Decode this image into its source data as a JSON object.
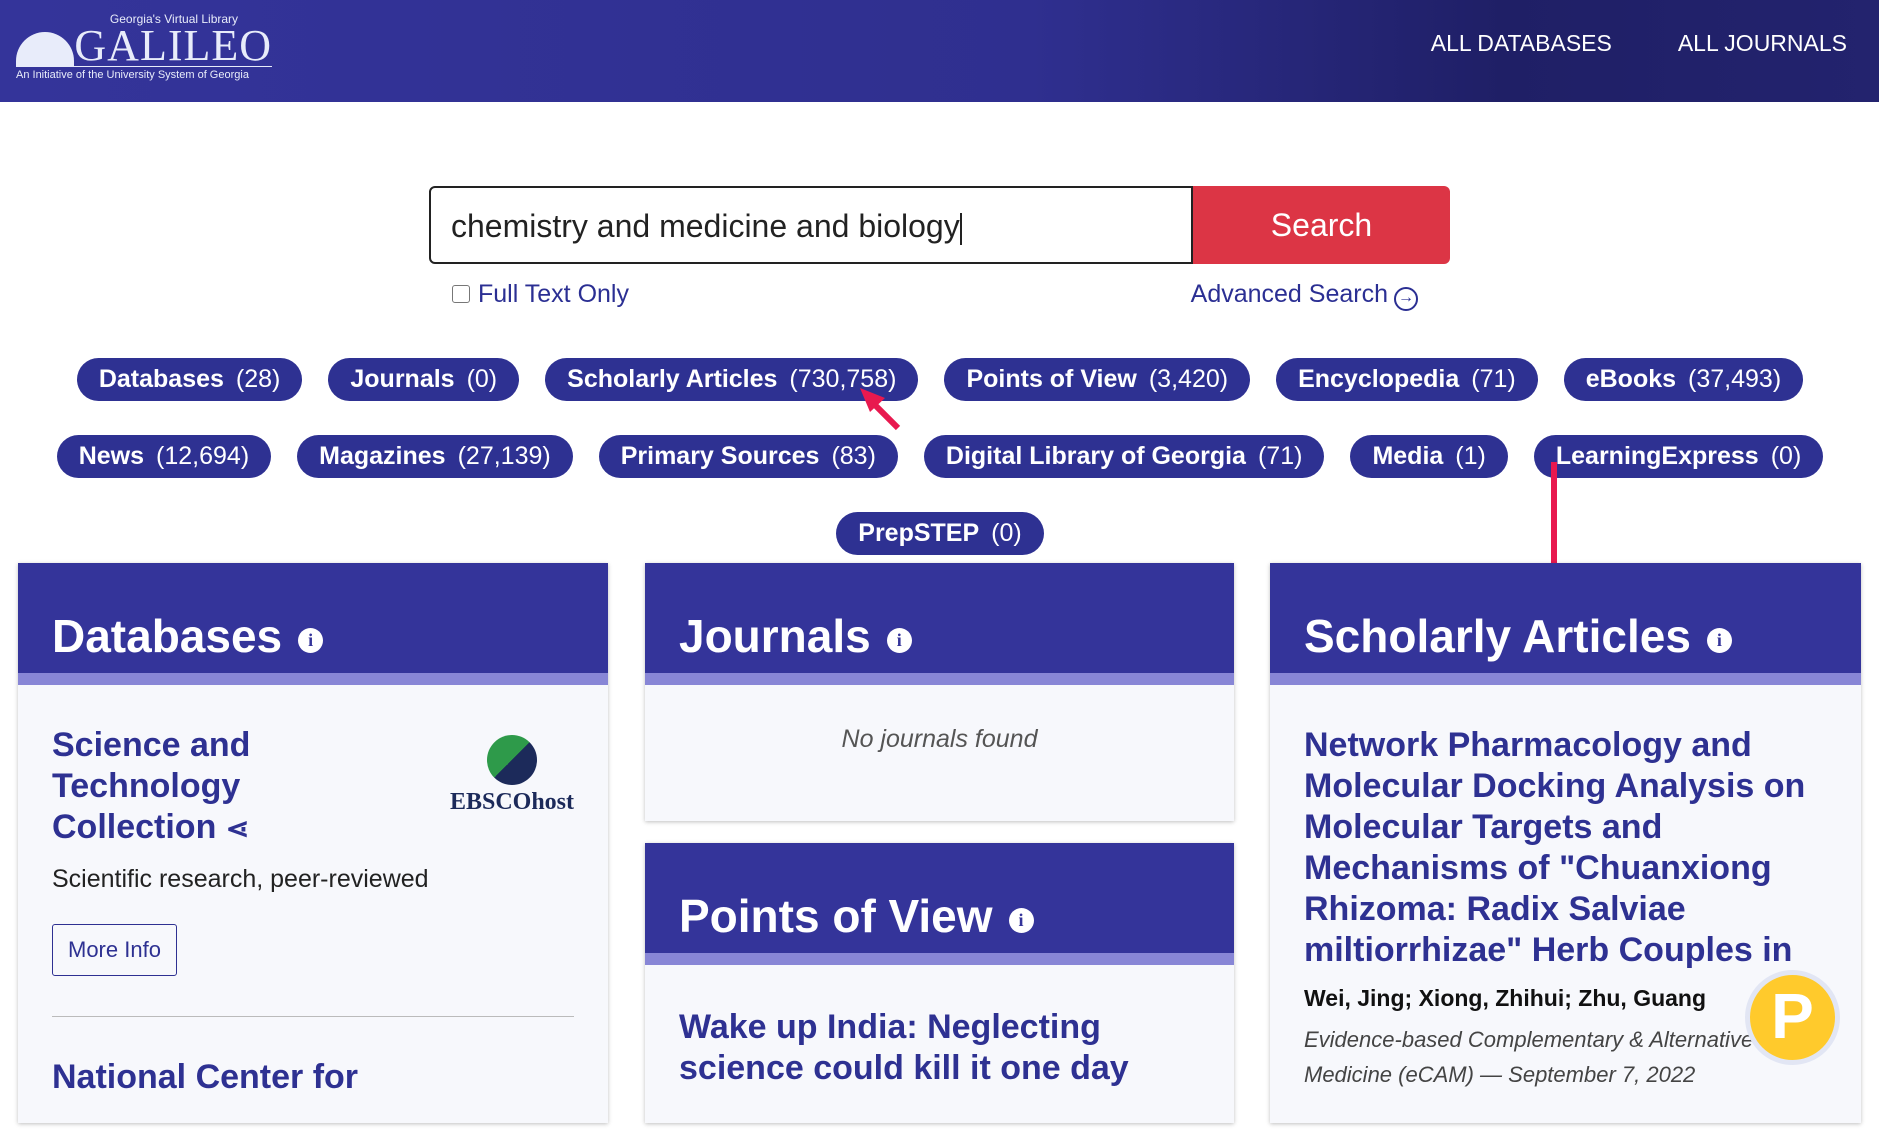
{
  "header": {
    "logo_top": "Georgia's Virtual Library",
    "logo_word": "GALILEO",
    "logo_sub": "An Initiative of the University System of Georgia",
    "nav": [
      "ALL DATABASES",
      "ALL JOURNALS"
    ]
  },
  "search": {
    "value": "chemistry and medicine and biology",
    "button": "Search",
    "full_text": "Full Text Only",
    "advanced": "Advanced Search"
  },
  "pills": [
    {
      "label": "Databases",
      "count": "(28)"
    },
    {
      "label": "Journals",
      "count": "(0)"
    },
    {
      "label": "Scholarly Articles",
      "count": "(730,758)"
    },
    {
      "label": "Points of View",
      "count": "(3,420)"
    },
    {
      "label": "Encyclopedia",
      "count": "(71)"
    },
    {
      "label": "eBooks",
      "count": "(37,493)"
    },
    {
      "label": "News",
      "count": "(12,694)"
    },
    {
      "label": "Magazines",
      "count": "(27,139)"
    },
    {
      "label": "Primary Sources",
      "count": "(83)"
    },
    {
      "label": "Digital Library of Georgia",
      "count": "(71)"
    },
    {
      "label": "Media",
      "count": "(1)"
    },
    {
      "label": "LearningExpress",
      "count": "(0)"
    },
    {
      "label": "PrepSTEP",
      "count": "(0)"
    }
  ],
  "databases": {
    "heading": "Databases",
    "item1": {
      "title": "Science and Technology Collection",
      "desc": "Scientific research, peer-reviewed",
      "more": "More Info",
      "logo": "EBSCOhost"
    },
    "item2_title": "National Center for"
  },
  "journals": {
    "heading": "Journals",
    "empty": "No journals found"
  },
  "pov": {
    "heading": "Points of View",
    "item_title": "Wake up India: Neglecting science could kill it one day"
  },
  "scholarly": {
    "heading": "Scholarly Articles",
    "title": "Network Pharmacology and Molecular Docking Analysis on Molecular Targets and Mechanisms of \"Chuanxiong Rhizoma: Radix Salviae miltiorrhizae\" Herb Couples in ...",
    "authors": "Wei, Jing; Xiong, Zhihui; Zhu, Guang",
    "source": "Evidence-based Complementary & Alternative Medicine (eCAM) — September 7, 2022"
  },
  "colors": {
    "brand": "#2e3192",
    "search_button": "#dc3545",
    "annotation_arrow": "#e8194f"
  }
}
